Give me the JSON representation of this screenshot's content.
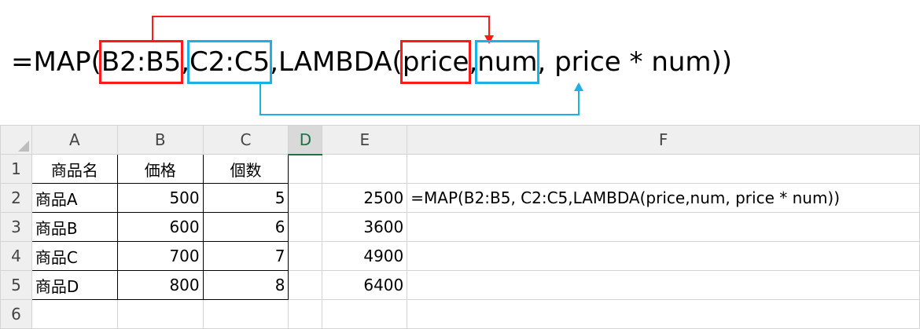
{
  "formula": {
    "prefix": "=MAP(",
    "arg1": "B2:B5",
    "sep1": " , ",
    "arg2": "C2:C5",
    "mid": " ,LAMBDA(",
    "param1": "price",
    "sep2": " , ",
    "param2": "num ",
    "suffix": ", price * num))"
  },
  "colors": {
    "red_box": "#ff1a1a",
    "blue_box": "#1cb0e6",
    "selected_col": "#1e7145"
  },
  "sheet": {
    "columns": [
      "A",
      "B",
      "C",
      "D",
      "E",
      "F"
    ],
    "selected_column": "D",
    "rows": [
      "1",
      "2",
      "3",
      "4",
      "5",
      "6"
    ],
    "headers": {
      "a": "商品名",
      "b": "価格",
      "c": "個数"
    },
    "data": [
      {
        "name": "商品A",
        "price": "500",
        "qty": "5",
        "result": "2500"
      },
      {
        "name": "商品B",
        "price": "600",
        "qty": "6",
        "result": "3600"
      },
      {
        "name": "商品C",
        "price": "700",
        "qty": "7",
        "result": "4900"
      },
      {
        "name": "商品D",
        "price": "800",
        "qty": "8",
        "result": "6400"
      }
    ],
    "f2_formula": "=MAP(B2:B5, C2:C5,LAMBDA(price,num, price * num))"
  }
}
